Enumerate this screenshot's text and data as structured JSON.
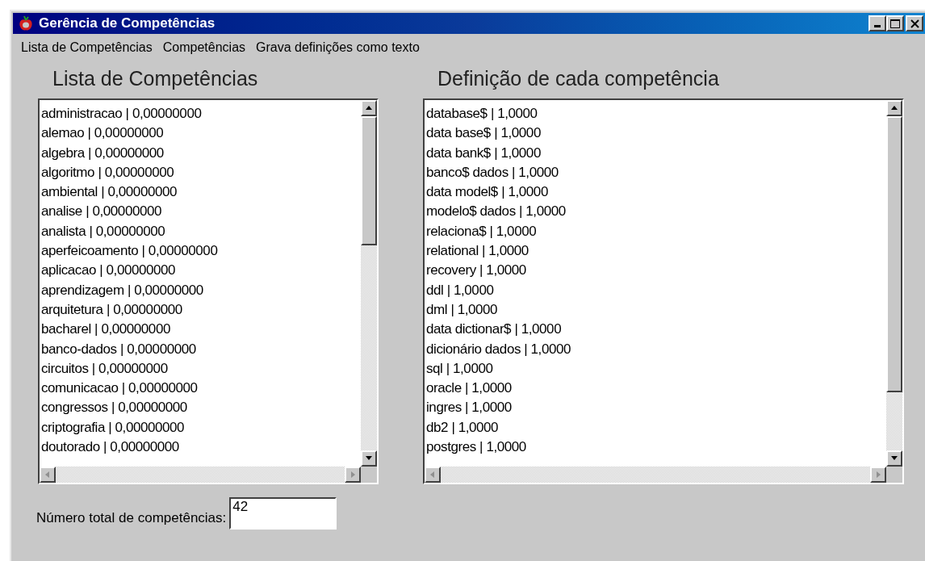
{
  "window": {
    "title": "Gerência de Competências"
  },
  "menu": [
    "Lista de Competências",
    "Competências",
    "Grava definições como texto"
  ],
  "left_panel": {
    "heading": "Lista de Competências",
    "items": [
      "administracao | 0,00000000",
      "alemao | 0,00000000",
      "algebra | 0,00000000",
      "algoritmo | 0,00000000",
      "ambiental | 0,00000000",
      "analise | 0,00000000",
      "analista | 0,00000000",
      "aperfeicoamento | 0,00000000",
      "aplicacao | 0,00000000",
      "aprendizagem | 0,00000000",
      "arquitetura | 0,00000000",
      "bacharel | 0,00000000",
      "banco-dados | 0,00000000",
      "circuitos | 0,00000000",
      "comunicacao | 0,00000000",
      "congressos | 0,00000000",
      "criptografia | 0,00000000",
      "doutorado | 0,00000000"
    ]
  },
  "right_panel": {
    "heading": "Definição de cada competência",
    "items": [
      "database$ | 1,0000",
      "data base$ | 1,0000",
      "data bank$ | 1,0000",
      "banco$ dados | 1,0000",
      "data model$ | 1,0000",
      "modelo$ dados | 1,0000",
      "relaciona$ | 1,0000",
      "relational | 1,0000",
      "recovery | 1,0000",
      "ddl | 1,0000",
      "dml | 1,0000",
      "data dictionar$ | 1,0000",
      "dicionário dados | 1,0000",
      "sql | 1,0000",
      "oracle | 1,0000",
      "ingres | 1,0000",
      "db2 | 1,0000",
      "postgres | 1,0000"
    ]
  },
  "total": {
    "label": "Número total de competências:",
    "value": "42"
  }
}
